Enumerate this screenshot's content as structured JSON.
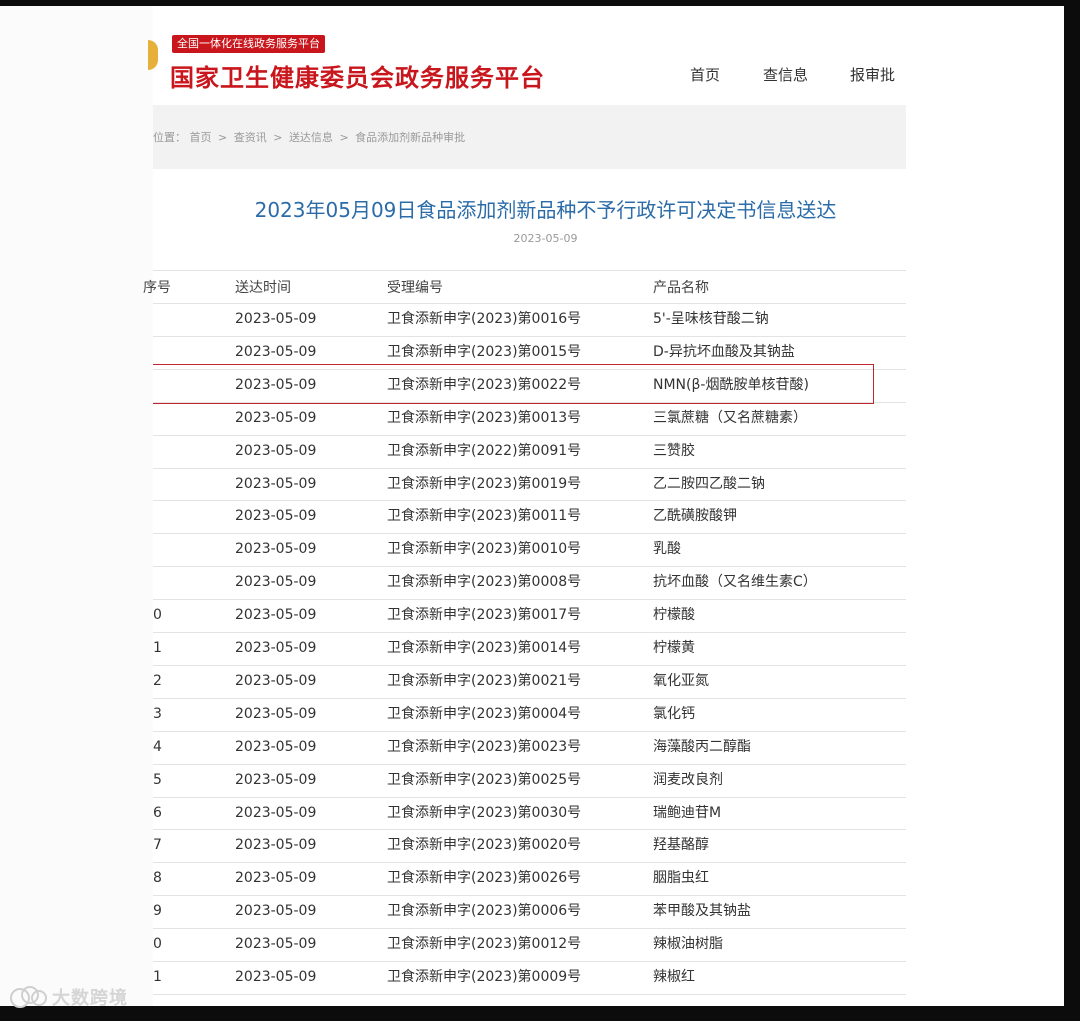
{
  "header": {
    "badge": "全国一体化在线政务服务平台",
    "site_title": "国家卫生健康委员会政务服务平台",
    "nav": [
      "首页",
      "查信息",
      "报审批"
    ]
  },
  "breadcrumb": {
    "items": [
      "位置：",
      "首页",
      "查资讯",
      "送达信息",
      "食品添加剂新品种审批"
    ],
    "separator": ">"
  },
  "article": {
    "title": "2023年05月09日食品添加剂新品种不予行政许可决定书信息送达",
    "date": "2023-05-09"
  },
  "table": {
    "headers": [
      "序号",
      "送达时间",
      "受理编号",
      "产品名称"
    ],
    "rows": [
      {
        "no": "",
        "date": "2023-05-09",
        "code": "卫食添新申字(2023)第0016号",
        "name": "5'-呈味核苷酸二钠"
      },
      {
        "no": "",
        "date": "2023-05-09",
        "code": "卫食添新申字(2023)第0015号",
        "name": "D-异抗坏血酸及其钠盐"
      },
      {
        "no": "",
        "date": "2023-05-09",
        "code": "卫食添新申字(2023)第0022号",
        "name": "NMN(β-烟酰胺单核苷酸)"
      },
      {
        "no": "",
        "date": "2023-05-09",
        "code": "卫食添新申字(2023)第0013号",
        "name": "三氯蔗糖（又名蔗糖素）"
      },
      {
        "no": "",
        "date": "2023-05-09",
        "code": "卫食添新申字(2022)第0091号",
        "name": "三赞胶"
      },
      {
        "no": "",
        "date": "2023-05-09",
        "code": "卫食添新申字(2023)第0019号",
        "name": "乙二胺四乙酸二钠"
      },
      {
        "no": "",
        "date": "2023-05-09",
        "code": "卫食添新申字(2023)第0011号",
        "name": "乙酰磺胺酸钾"
      },
      {
        "no": "",
        "date": "2023-05-09",
        "code": "卫食添新申字(2023)第0010号",
        "name": "乳酸"
      },
      {
        "no": "",
        "date": "2023-05-09",
        "code": "卫食添新申字(2023)第0008号",
        "name": "抗坏血酸（又名维生素C）"
      },
      {
        "no": "0",
        "date": "2023-05-09",
        "code": "卫食添新申字(2023)第0017号",
        "name": "柠檬酸"
      },
      {
        "no": "1",
        "date": "2023-05-09",
        "code": "卫食添新申字(2023)第0014号",
        "name": "柠檬黄"
      },
      {
        "no": "2",
        "date": "2023-05-09",
        "code": "卫食添新申字(2023)第0021号",
        "name": "氧化亚氮"
      },
      {
        "no": "3",
        "date": "2023-05-09",
        "code": "卫食添新申字(2023)第0004号",
        "name": "氯化钙"
      },
      {
        "no": "4",
        "date": "2023-05-09",
        "code": "卫食添新申字(2023)第0023号",
        "name": "海藻酸丙二醇酯"
      },
      {
        "no": "5",
        "date": "2023-05-09",
        "code": "卫食添新申字(2023)第0025号",
        "name": "润麦改良剂"
      },
      {
        "no": "6",
        "date": "2023-05-09",
        "code": "卫食添新申字(2023)第0030号",
        "name": "瑞鲍迪苷M"
      },
      {
        "no": "7",
        "date": "2023-05-09",
        "code": "卫食添新申字(2023)第0020号",
        "name": "羟基酪醇"
      },
      {
        "no": "8",
        "date": "2023-05-09",
        "code": "卫食添新申字(2023)第0026号",
        "name": "胭脂虫红"
      },
      {
        "no": "9",
        "date": "2023-05-09",
        "code": "卫食添新申字(2023)第0006号",
        "name": "苯甲酸及其钠盐"
      },
      {
        "no": "0",
        "date": "2023-05-09",
        "code": "卫食添新申字(2023)第0012号",
        "name": "辣椒油树脂"
      },
      {
        "no": "1",
        "date": "2023-05-09",
        "code": "卫食添新申字(2023)第0009号",
        "name": "辣椒红"
      }
    ]
  },
  "watermark": {
    "text": "大数跨境"
  },
  "colors": {
    "brand_red": "#c9161d",
    "title_blue": "#2b6ca8",
    "highlight_red": "#c0262d"
  }
}
